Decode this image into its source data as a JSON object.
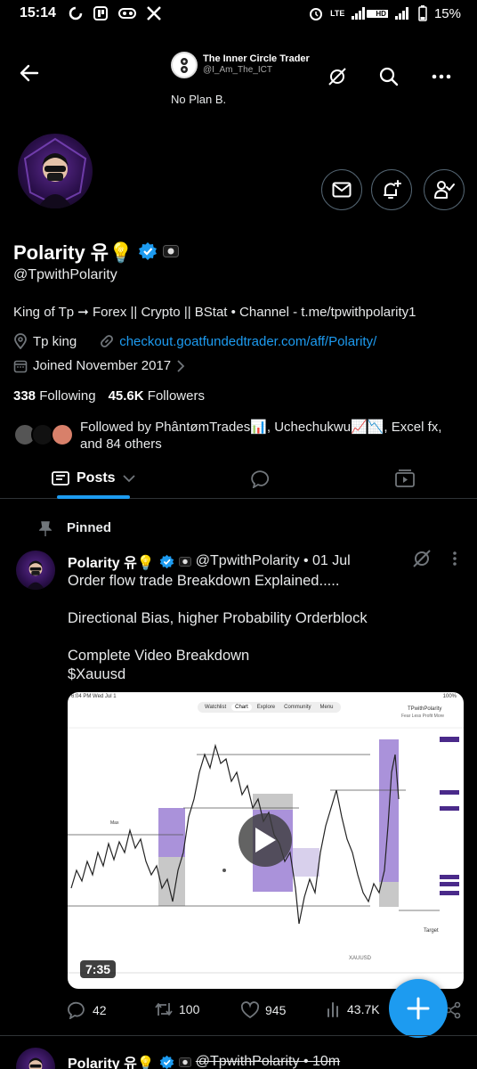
{
  "status_bar": {
    "time": "15:14",
    "battery": "15%",
    "network_labels": [
      "LTE",
      "HD"
    ]
  },
  "header": {
    "ict_name": "The Inner Circle Trader",
    "ict_handle": "@I_Am_The_ICT",
    "tagline": "No Plan B."
  },
  "profile": {
    "display_name": "Polarity 유💡",
    "handle": "@TpwithPolarity",
    "bio": "King of Tp ➞ Forex || Crypto || BStat • Channel - t.me/tpwithpolarity1",
    "location": "Tp king",
    "website": "checkout.goatfundedtrader.com/aff/Polarity/",
    "joined": "Joined November 2017",
    "following_count": "338",
    "following_label": "Following",
    "followers_count": "45.6K",
    "followers_label": "Followers",
    "followed_by": "Followed by PhântømTrades📊, Uchechukwu📈📉, Excel fx, and 84 others"
  },
  "tabs": {
    "posts_label": "Posts"
  },
  "pinned_post": {
    "pinned_label": "Pinned",
    "author": "Polarity 유💡",
    "handle_time": "@TpwithPolarity • 01 Jul",
    "paragraphs": [
      "Order flow trade Breakdown Explained.....",
      "Directional Bias, higher Probability Orderblock",
      "Complete Video Breakdown\n$Xauusd"
    ],
    "video_duration": "7:35",
    "replies": "42",
    "reposts": "100",
    "likes": "945",
    "views": "43.7K",
    "chart_tabs": [
      "Watchlist",
      "Chart",
      "Explore",
      "Community",
      "Menu"
    ],
    "chart_symbol": "XAUUSD",
    "chart_top_left": "6:04 PM  Wed Jul 1",
    "chart_top_right": "100%",
    "chart_title": "TPwithPolarity",
    "chart_subtitle": "Fear Less Profit More",
    "chart_target_label": "Target",
    "chart_max_label": "Max"
  },
  "next_post": {
    "author": "Polarity 유💡",
    "handle_time": "@TpwithPolarity • 10m"
  },
  "colors": {
    "accent": "#1d9bf0",
    "background": "#000000",
    "purple_zone": "#9b7fd4"
  }
}
